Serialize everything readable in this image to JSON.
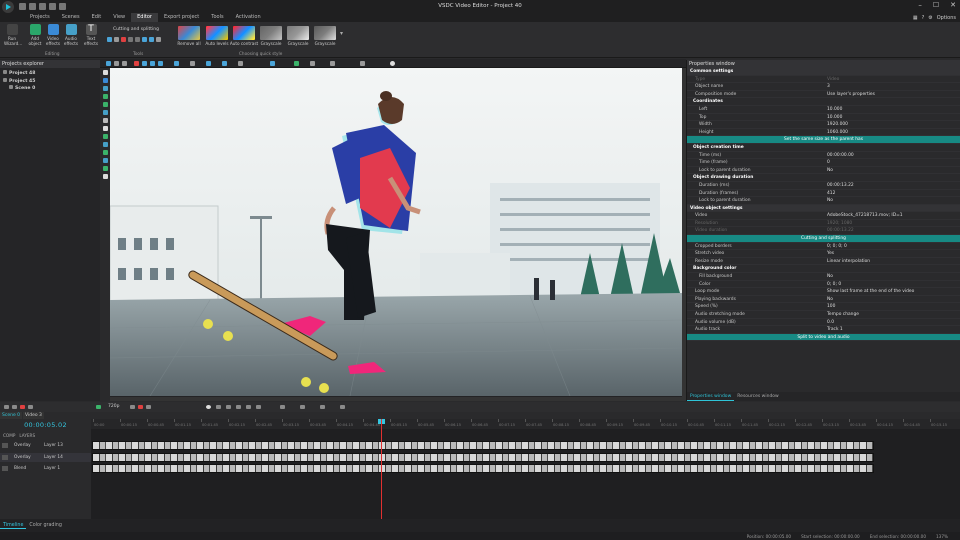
{
  "window": {
    "title": "VSDC Video Editor - Project 40"
  },
  "titlebar": {
    "minimize": "–",
    "maximize": "☐",
    "close": "✕"
  },
  "menu": {
    "items": [
      "Projects",
      "Scenes",
      "Edit",
      "View",
      "Editor",
      "Export project",
      "Tools",
      "Activation"
    ],
    "options": "Options"
  },
  "ribbon": {
    "run_wizard": "Run Wizard...",
    "add_object": "Add object",
    "video_effects": "Video effects",
    "audio_effects": "Audio effects",
    "text_effects": "Text effects",
    "editing_label": "Editing",
    "cutting_label": "Cutting and splitting",
    "tools_label": "Tools",
    "quick_styles": [
      "Remove all",
      "Auto levels",
      "Auto contrast",
      "Grayscale",
      "Grayscale",
      "Grayscale"
    ],
    "quick_style_label": "Choosing quick style"
  },
  "explorer": {
    "title": "Projects explorer",
    "items": [
      "Project 48",
      "Project 45",
      "Scene 0"
    ]
  },
  "properties": {
    "title": "Properties window",
    "rows": [
      {
        "t": "sec",
        "k": "Common settings",
        "v": ""
      },
      {
        "t": "dim",
        "k": "Type",
        "v": "Video"
      },
      {
        "t": "",
        "k": "Object name",
        "v": "3"
      },
      {
        "t": "",
        "k": "Composition mode",
        "v": "Use layer's properties"
      },
      {
        "t": "sub",
        "k": "Coordinates",
        "v": ""
      },
      {
        "t": "deep",
        "k": "Left",
        "v": "10.000"
      },
      {
        "t": "deep",
        "k": "Top",
        "v": "10.000"
      },
      {
        "t": "deep",
        "k": "Width",
        "v": "1920.000"
      },
      {
        "t": "deep",
        "k": "Height",
        "v": "1060.000"
      },
      {
        "t": "btn",
        "k": "Set the same size as the parent has",
        "v": ""
      },
      {
        "t": "sub",
        "k": "Object creation time",
        "v": ""
      },
      {
        "t": "deep",
        "k": "Time (ms)",
        "v": "00:00:00.00"
      },
      {
        "t": "deep",
        "k": "Time (frame)",
        "v": "0"
      },
      {
        "t": "deep",
        "k": "Lock to parent duration",
        "v": "No"
      },
      {
        "t": "sub",
        "k": "Object drawing duration",
        "v": ""
      },
      {
        "t": "deep",
        "k": "Duration (ms)",
        "v": "00:00:13.22"
      },
      {
        "t": "deep",
        "k": "Duration (frames)",
        "v": "412"
      },
      {
        "t": "deep",
        "k": "Lock to parent duration",
        "v": "No"
      },
      {
        "t": "sec",
        "k": "Video object settings",
        "v": ""
      },
      {
        "t": "",
        "k": "Video",
        "v": "AdobeStock_47218713.mov; ID=1"
      },
      {
        "t": "dim",
        "k": "Resolution",
        "v": "1920; 1080"
      },
      {
        "t": "dim",
        "k": "Video duration",
        "v": "00:00:13.22"
      },
      {
        "t": "btn",
        "k": "Cutting and splitting",
        "v": ""
      },
      {
        "t": "",
        "k": "Cropped borders",
        "v": "0; 0; 0; 0"
      },
      {
        "t": "",
        "k": "Stretch video",
        "v": "Yes"
      },
      {
        "t": "",
        "k": "Resize mode",
        "v": "Linear interpolation"
      },
      {
        "t": "sub",
        "k": "Background color",
        "v": ""
      },
      {
        "t": "deep",
        "k": "Fill background",
        "v": "No"
      },
      {
        "t": "deep",
        "k": "Color",
        "v": "0; 0; 0"
      },
      {
        "t": "",
        "k": "Loop mode",
        "v": "Show last frame at the end of the video"
      },
      {
        "t": "",
        "k": "Playing backwards",
        "v": "No"
      },
      {
        "t": "",
        "k": "Speed (%)",
        "v": "100"
      },
      {
        "t": "",
        "k": "Audio stretching mode",
        "v": "Tempo change"
      },
      {
        "t": "",
        "k": "Audio volume (dB)",
        "v": "0.0"
      },
      {
        "t": "",
        "k": "Audio track",
        "v": "Track 1"
      },
      {
        "t": "btn",
        "k": "Split to video and audio",
        "v": ""
      }
    ],
    "tabs": [
      "Properties window",
      "Resources window"
    ]
  },
  "scene_tabs": [
    "Scene 0",
    "Video 3"
  ],
  "timeline": {
    "timecode": "00:00:05.02",
    "headers": [
      "COMP",
      "LAYERS"
    ],
    "tracks": [
      {
        "blend": "Overlay",
        "layer": "Layer 13"
      },
      {
        "blend": "Overlay",
        "layer": "Layer 14"
      },
      {
        "blend": "Blend",
        "layer": "Layer 1"
      }
    ],
    "ruler": [
      "00:00",
      "00:00.15",
      "00:00.45",
      "00:01.15",
      "00:01.45",
      "00:02.15",
      "00:02.45",
      "00:03.15",
      "00:03.45",
      "00:04.15",
      "00:04.45",
      "00:05.15",
      "00:05.45",
      "00:06.15",
      "00:06.45",
      "00:07.15",
      "00:07.45",
      "00:08.15",
      "00:08.45",
      "00:09.15",
      "00:09.45",
      "00:10.15",
      "00:10.45",
      "00:11.15",
      "00:11.45",
      "00:12.15",
      "00:12.45",
      "00:13.15",
      "00:13.45",
      "00:14.15",
      "00:14.45",
      "00:15.15"
    ],
    "zoom": "720p"
  },
  "bottom_tabs": [
    "Timeline",
    "Color grading"
  ],
  "status": {
    "position": "Position: 00:00:05.00",
    "start": "Start selection: 00:00:00.00",
    "end": "End selection: 00:00:00.00",
    "zoom": "137%"
  }
}
